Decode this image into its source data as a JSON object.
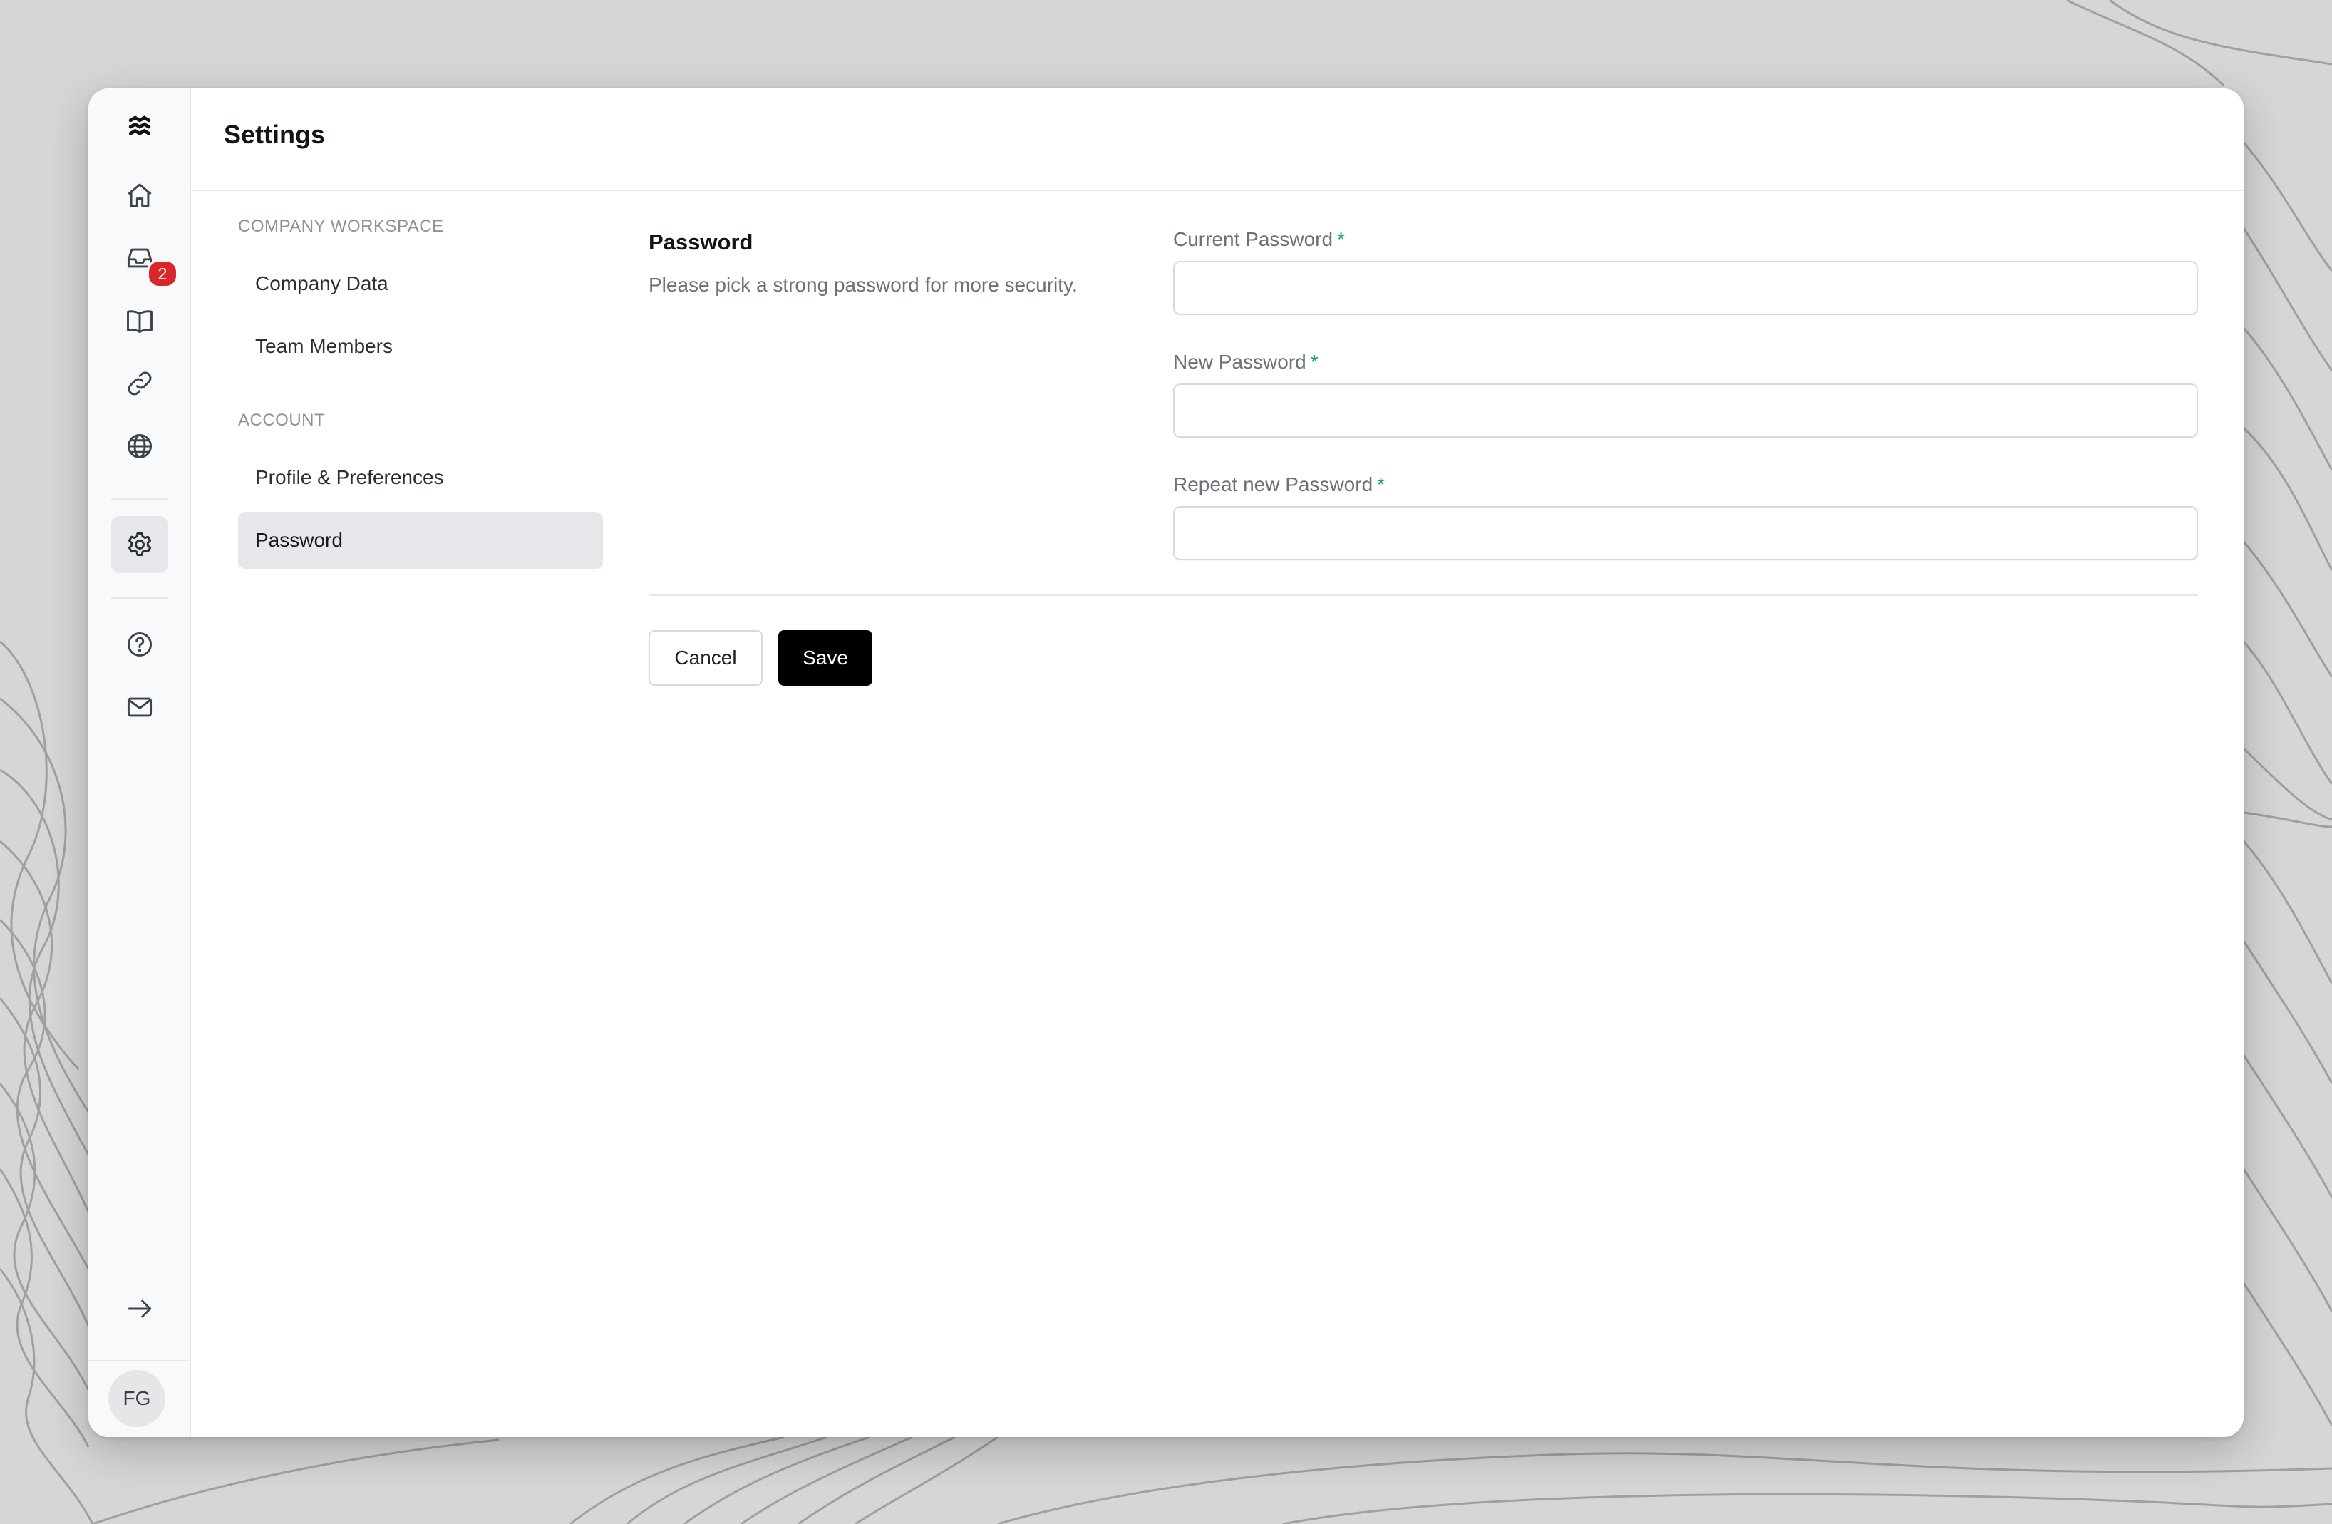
{
  "app": {
    "page_title": "Settings"
  },
  "rail": {
    "items": [
      {
        "icon": "logo-icon",
        "label": ""
      },
      {
        "icon": "home-icon",
        "label": ""
      },
      {
        "icon": "inbox-icon",
        "label": "",
        "badge": "2"
      },
      {
        "icon": "book-icon",
        "label": ""
      },
      {
        "icon": "link-icon",
        "label": ""
      },
      {
        "icon": "globe-icon",
        "label": ""
      },
      {
        "icon": "gear-icon",
        "label": "",
        "active": true
      },
      {
        "icon": "help-icon",
        "label": ""
      },
      {
        "icon": "mail-icon",
        "label": ""
      },
      {
        "icon": "arrow-right-icon",
        "label": ""
      }
    ],
    "inbox_badge": "2",
    "avatar_initials": "FG"
  },
  "nav": {
    "sections": [
      {
        "title": "COMPANY WORKSPACE",
        "items": [
          {
            "label": "Company Data"
          },
          {
            "label": "Team Members"
          }
        ]
      },
      {
        "title": "ACCOUNT",
        "items": [
          {
            "label": "Profile & Preferences"
          },
          {
            "label": "Password",
            "active": true
          }
        ]
      }
    ]
  },
  "form": {
    "title": "Password",
    "description": "Please pick a strong password for more security.",
    "fields": [
      {
        "label": "Current Password",
        "required": "*",
        "value": "",
        "placeholder": ""
      },
      {
        "label": "New Password",
        "required": "*",
        "value": "",
        "placeholder": ""
      },
      {
        "label": "Repeat new Password",
        "required": "*",
        "value": "",
        "placeholder": ""
      }
    ],
    "cancel_label": "Cancel",
    "save_label": "Save"
  },
  "colors": {
    "background": "#d6d6d6",
    "accent": "#000000",
    "required_marker": "#1aa267",
    "badge": "#d9262b",
    "active_nav": "#e6e7ea"
  }
}
